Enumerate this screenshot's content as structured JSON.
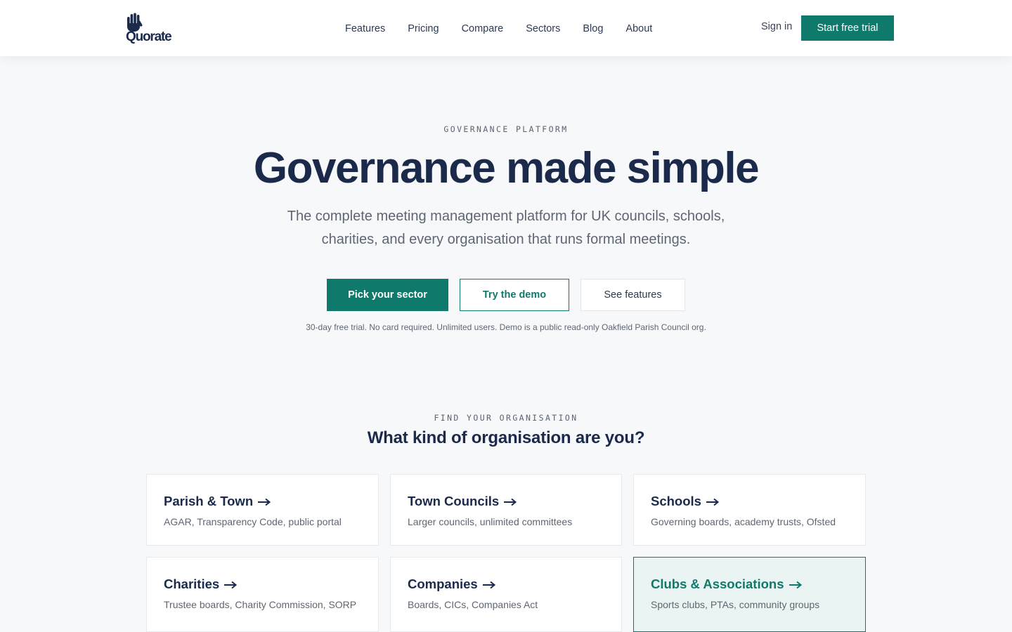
{
  "brand": {
    "name": "Quorate",
    "logo_icon": "raised-hand-icon"
  },
  "nav": {
    "items": [
      "Features",
      "Pricing",
      "Compare",
      "Sectors",
      "Blog",
      "About"
    ],
    "signin_label": "Sign in",
    "trial_label": "Start free trial"
  },
  "hero": {
    "eyebrow": "GOVERNANCE PLATFORM",
    "title": "Governance made simple",
    "subtitle": "The complete meeting management platform for UK councils, schools, charities, and every organisation that runs formal meetings.",
    "primary_cta": "Pick your sector",
    "secondary_cta": "Try the demo",
    "tertiary_cta": "See features",
    "note": "30-day free trial. No card required. Unlimited users. Demo is a public read-only Oakfield Parish Council org."
  },
  "sectors": {
    "eyebrow": "FIND YOUR ORGANISATION",
    "title": "What kind of organisation are you?",
    "cards": [
      {
        "title": "Parish & Town",
        "desc": "AGAR, Transparency Code, public portal"
      },
      {
        "title": "Town Councils",
        "desc": "Larger councils, unlimited committees"
      },
      {
        "title": "Schools",
        "desc": "Governing boards, academy trusts, Ofsted"
      },
      {
        "title": "Charities",
        "desc": "Trustee boards, Charity Commission, SORP"
      },
      {
        "title": "Companies",
        "desc": "Boards, CICs, Companies Act"
      },
      {
        "title": "Clubs & Associations",
        "desc": "Sports clubs, PTAs, community groups",
        "highlighted": true
      }
    ]
  },
  "colors": {
    "accent": "#0f7a6c",
    "navy": "#1b2a4a",
    "background": "#f6f8fa",
    "highlight_bg": "#eaf4f2"
  }
}
